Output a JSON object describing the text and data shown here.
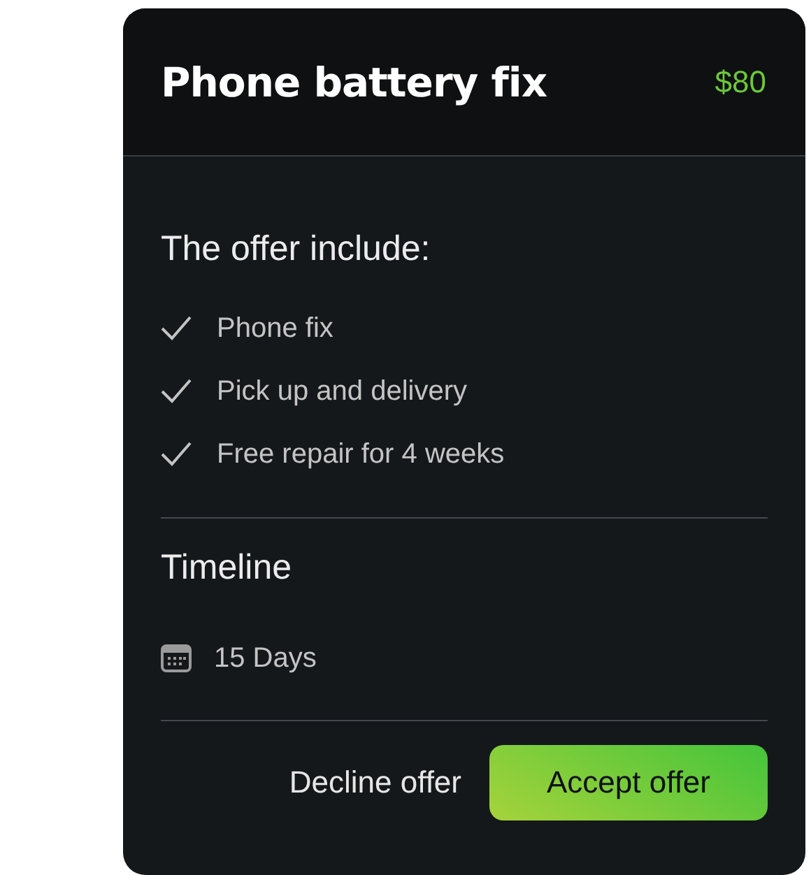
{
  "offer": {
    "title": "Phone battery fix",
    "price": "$80"
  },
  "includes": {
    "heading": "The offer include:",
    "items": [
      "Phone fix",
      "Pick up and delivery",
      "Free repair for 4 weeks"
    ]
  },
  "timeline": {
    "heading": "Timeline",
    "duration": "15 Days"
  },
  "buttons": {
    "decline": "Decline offer",
    "accept": "Accept offer"
  }
}
